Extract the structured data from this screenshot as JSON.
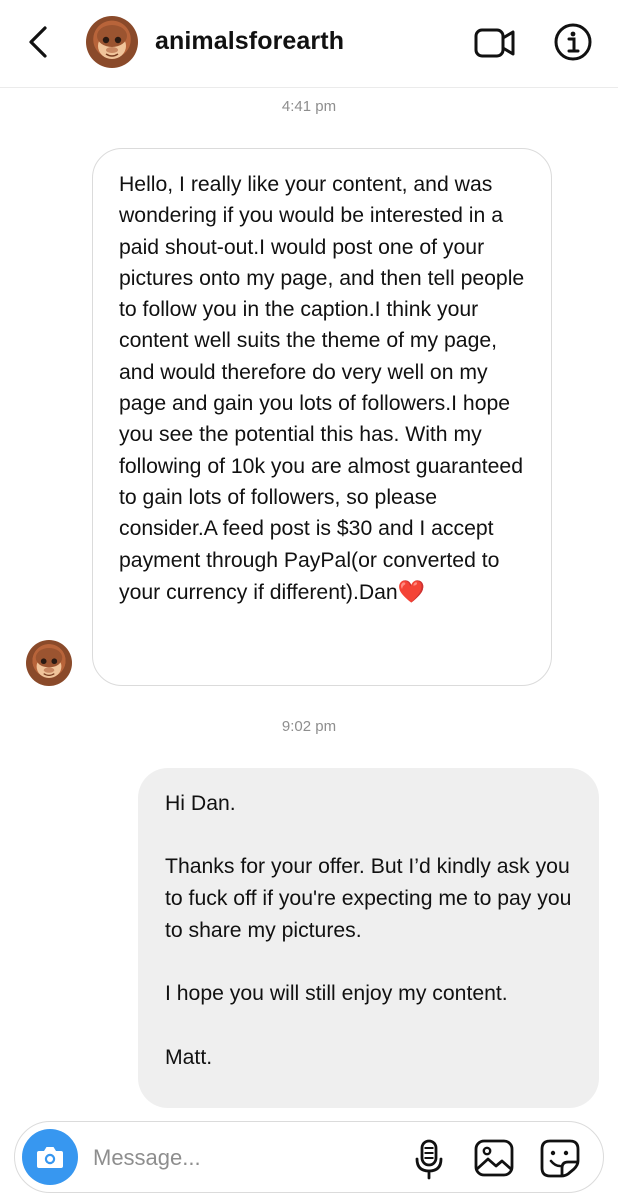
{
  "header": {
    "username": "animalsforearth",
    "icons": {
      "back": "chevron-left-icon",
      "video": "video-call-icon",
      "info": "info-icon"
    }
  },
  "conversation": [
    {
      "type": "timestamp",
      "text": "4:41 pm"
    },
    {
      "type": "incoming",
      "text": "Hello, I really like your content, and was wondering if you would be interested in a paid shout-out.I would post one of your pictures onto my page, and then tell people to follow you in the caption.I think your content well suits the theme of my page, and would therefore do very well on my page and gain you lots of followers.I hope you see the potential this has. With my following of 10k you are almost guaranteed to gain lots of followers, so please consider.A feed post is $30 and I accept payment through PayPal(or converted to your currency if different).Dan",
      "emoji": "❤️"
    },
    {
      "type": "timestamp",
      "text": "9:02 pm"
    },
    {
      "type": "outgoing",
      "paragraphs": [
        "Hi Dan.",
        "Thanks for your offer. But I’d kindly ask you to fuck off if you're expecting me to pay you to share my pictures.",
        "I hope you will still enjoy my content.",
        "Matt."
      ]
    }
  ],
  "composer": {
    "placeholder": "Message...",
    "icons": [
      "camera-icon",
      "microphone-icon",
      "gallery-icon",
      "sticker-icon"
    ]
  },
  "colors": {
    "accent": "#3797f0",
    "outgoing_bubble": "#efefef",
    "incoming_border": "#dbdbdb",
    "timestamp": "#8e8e8e",
    "heart": "#e0252f"
  }
}
